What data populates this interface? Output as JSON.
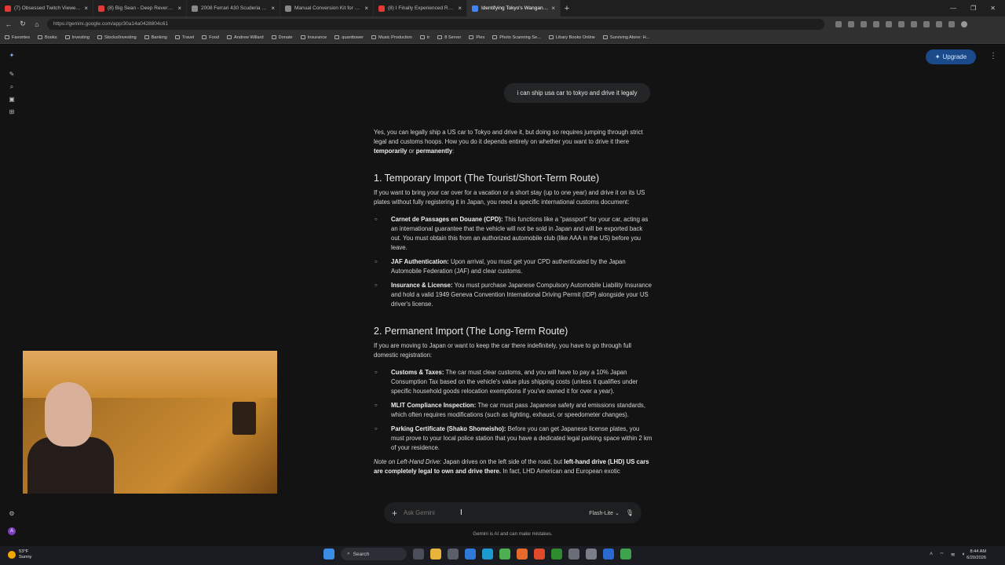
{
  "browser": {
    "tabs": [
      {
        "title": "(7) Obsessed Twitch Viewer Arre...",
        "color": "#e53935"
      },
      {
        "title": "(8) Big Sean - Deep Reverence",
        "color": "#e53935"
      },
      {
        "title": "2008 Ferrari 430 Scuderia 6-Speed",
        "color": "#888888"
      },
      {
        "title": "Manual Conversion Kit for Ferrari",
        "color": "#888888"
      },
      {
        "title": "(8) I Finally Experienced REAL Stree...",
        "color": "#e53935"
      },
      {
        "title": "Identifying Tokyo's Wangan Expr...",
        "color": "#4285f4"
      }
    ],
    "url": "https://gemini.google.com/app/30a14a0428804c61",
    "bookmarks": [
      "Favorites",
      "Books",
      "Investing",
      "Stocks/Investing",
      "Banking",
      "Travel",
      "Food",
      "Andrew Willard",
      "Donate",
      "Insurance",
      "quanttower",
      "Music Production",
      "tr",
      "8 Server",
      "Plex",
      "Photo Scanning Se...",
      "Libary Books Online",
      "Surviving Alone: H..."
    ]
  },
  "app": {
    "upgrade_label": "Upgrade",
    "user_query": "i can ship usa car to tokyo and drive it legaly",
    "response": {
      "intro_a": "Yes, you can legally ship a US car to Tokyo and drive it, but doing so requires jumping through strict legal and customs hoops. How you do it depends entirely on whether you want to drive it there ",
      "intro_temp": "temporarily",
      "intro_or": " or ",
      "intro_perm": "permanently",
      "intro_end": ":",
      "h1": "1. Temporary Import (The Tourist/Short-Term Route)",
      "p1": "If you want to bring your car over for a vacation or a short stay (up to one year) and drive it on its US plates without fully registering it in Japan, you need a specific international customs document:",
      "list1": [
        {
          "b": "Carnet de Passages en Douane (CPD):",
          "t": " This functions like a \"passport\" for your car, acting as an international guarantee that the vehicle will not be sold in Japan and will be exported back out. You must obtain this from an authorized automobile club (like AAA in the US) before you leave."
        },
        {
          "b": "JAF Authentication:",
          "t": " Upon arrival, you must get your CPD authenticated by the Japan Automobile Federation (JAF) and clear customs."
        },
        {
          "b": "Insurance & License:",
          "t": " You must purchase Japanese Compulsory Automobile Liability Insurance and hold a valid 1949 Geneva Convention International Driving Permit (IDP) alongside your US driver's license."
        }
      ],
      "h2": "2. Permanent Import (The Long-Term Route)",
      "p2": "If you are moving to Japan or want to keep the car there indefinitely, you have to go through full domestic registration:",
      "list2": [
        {
          "b": "Customs & Taxes:",
          "t": " The car must clear customs, and you will have to pay a 10% Japan Consumption Tax based on the vehicle's value plus shipping costs (unless it qualifies under specific household goods relocation exemptions if you've owned it for over a year)."
        },
        {
          "b": "MLIT Compliance Inspection:",
          "t": " The car must pass Japanese safety and emissions standards, which often requires modifications (such as lighting, exhaust, or speedometer changes)."
        },
        {
          "b": "Parking Certificate (Shako Shomeisho):",
          "t": " Before you can get Japanese license plates, you must prove to your local police station that you have a dedicated legal parking space within 2 km of your residence."
        }
      ],
      "note_label": "Note on Left-Hand Drive:",
      "note_text": " Japan drives on the left side of the road, but ",
      "note_bold": "left-hand drive (LHD) US cars are completely legal to own and drive there.",
      "note_tail": " In fact, LHD American and European exotic"
    },
    "composer": {
      "placeholder": "Ask Gemini",
      "model": "Flash-Lite"
    },
    "disclaimer": "Gemini is AI and can make mistakes."
  },
  "taskbar": {
    "weather_temp": "53°F",
    "weather_desc": "Sunny",
    "search_label": "Search",
    "time": "8:44 AM",
    "date": "6/20/2026"
  }
}
